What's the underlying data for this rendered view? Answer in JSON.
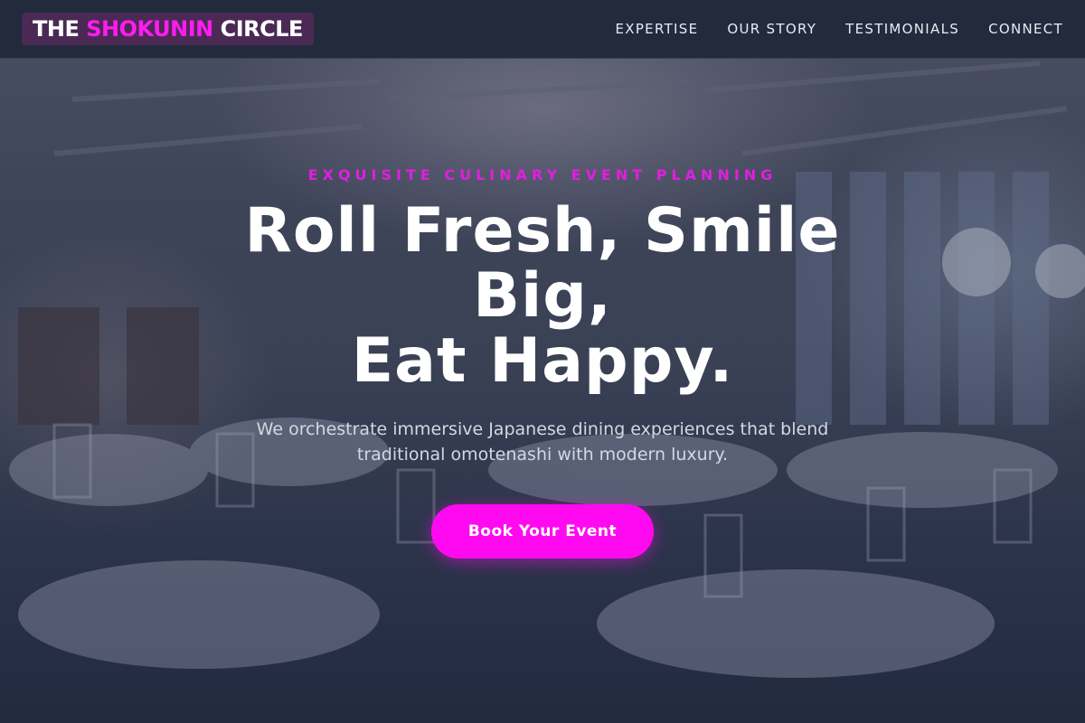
{
  "header": {
    "logo": {
      "part1": "THE ",
      "part2": "SHOKUNIN",
      "part3": " CIRCLE"
    },
    "nav": [
      "EXPERTISE",
      "OUR STORY",
      "TESTIMONIALS",
      "CONNECT"
    ]
  },
  "hero": {
    "eyebrow": "EXQUISITE CULINARY EVENT PLANNING",
    "headline_line1": "Roll Fresh, Smile Big,",
    "headline_line2": "Eat Happy.",
    "subhead": "We orchestrate immersive Japanese dining experiences that blend traditional omotenashi with modern luxury.",
    "cta": "Book Your Event"
  },
  "colors": {
    "accent": "#ff0af0",
    "header_bg": "#222a3c",
    "page_bg": "#1f2840"
  }
}
